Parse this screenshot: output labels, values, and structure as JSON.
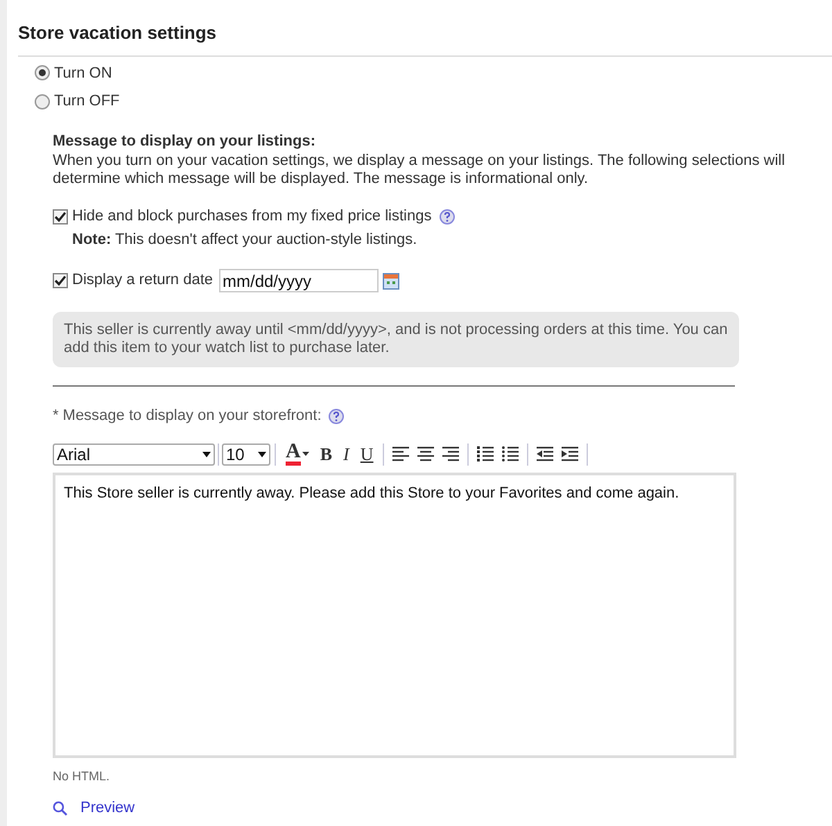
{
  "title": "Store vacation settings",
  "mode": [
    {
      "label": "Turn ON",
      "selected": true
    },
    {
      "label": "Turn OFF",
      "selected": false
    }
  ],
  "listings": {
    "heading": "Message to display on your listings:",
    "description": "When you turn on your vacation settings, we display a message on your listings. The following selections will determine which message will be displayed. The message is informational only.",
    "hide_option": {
      "label": "Hide and block purchases from my fixed price listings",
      "checked": true,
      "note": "**Note:** This doesn't affect your auction-style listings."
    },
    "return_date": {
      "label": "Display a return date",
      "checked": true,
      "value": "mm/dd/yyyy"
    },
    "preview_message": "This seller is currently away until <mm/dd/yyyy>, and is not processing orders at this time. You can add this item to your watch list to purchase later."
  },
  "storefront": {
    "required_mark": "*",
    "label": "Message to display on your storefront:",
    "toolbar": {
      "font": "Arial",
      "size": "10",
      "buttons": [
        {
          "kind": "color",
          "text": "A"
        },
        {
          "kind": "bold",
          "text": "B"
        },
        {
          "kind": "italic",
          "text": "I"
        },
        {
          "kind": "underline",
          "text": "U"
        },
        {
          "kind": "align-left"
        },
        {
          "kind": "align-center"
        },
        {
          "kind": "align-right"
        },
        {
          "kind": "numbered-list"
        },
        {
          "kind": "bulleted-list"
        },
        {
          "kind": "outdent"
        },
        {
          "kind": "indent"
        }
      ]
    },
    "message": "This Store seller is currently away. Please add this Store to your Favorites and come again.",
    "hint": "No HTML.",
    "preview_link": "Preview"
  }
}
